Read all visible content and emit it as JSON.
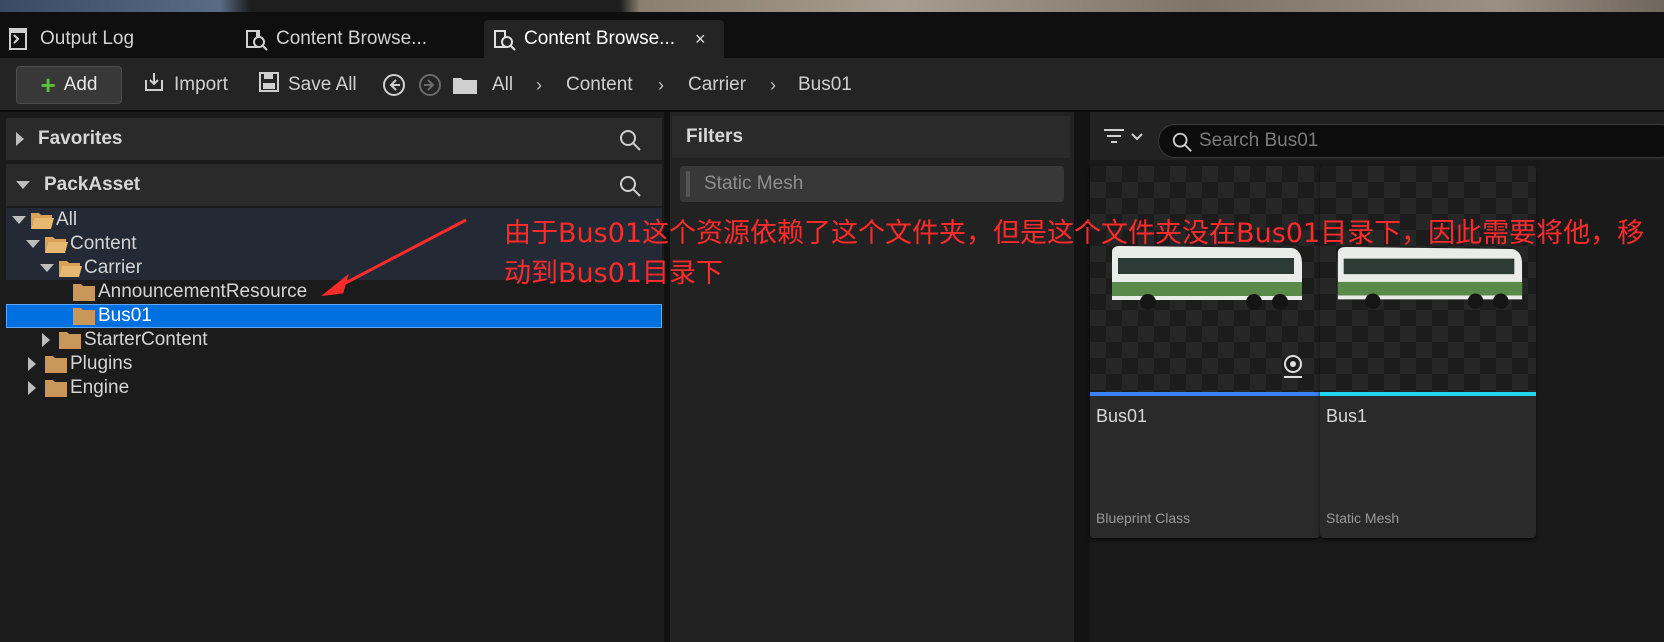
{
  "tabs": [
    {
      "label": "Output Log",
      "icon": "output-log-icon"
    },
    {
      "label": "Content Browse...",
      "icon": "content-browser-icon"
    },
    {
      "label": "Content Browse...",
      "icon": "content-browser-icon",
      "close": "×"
    }
  ],
  "toolbar": {
    "add_label": "Add",
    "import_label": "Import",
    "save_all_label": "Save All",
    "breadcrumbs": [
      "All",
      "Content",
      "Carrier",
      "Bus01"
    ]
  },
  "left": {
    "favorites_label": "Favorites",
    "packasset_label": "PackAsset",
    "tree": [
      {
        "label": "All"
      },
      {
        "label": "Content"
      },
      {
        "label": "Carrier"
      },
      {
        "label": "AnnouncementResource"
      },
      {
        "label": "Bus01"
      },
      {
        "label": "StarterContent"
      },
      {
        "label": "Plugins"
      },
      {
        "label": "Engine"
      }
    ]
  },
  "filters": {
    "title": "Filters",
    "chip": "Static Mesh"
  },
  "assets": {
    "search_placeholder": "Search Bus01",
    "items": [
      {
        "name": "Bus01",
        "type": "Blueprint Class",
        "accent": "#3b82f6"
      },
      {
        "name": "Bus1",
        "type": "Static Mesh",
        "accent": "#22d3ee"
      }
    ]
  },
  "annotation": {
    "text": "由于Bus01这个资源依赖了这个文件夹，但是这个文件夹没在Bus01目录下，因此需要将他，移动到Bus01目录下",
    "color": "#ff2a2a"
  }
}
